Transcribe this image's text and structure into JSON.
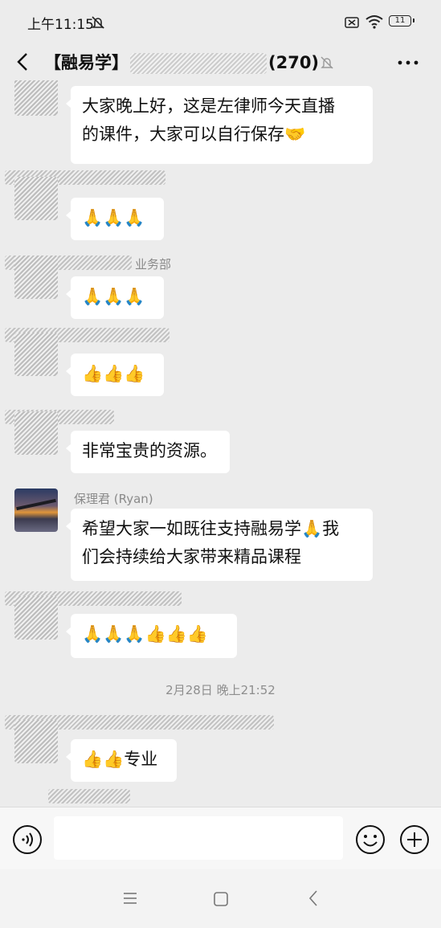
{
  "status_bar": {
    "time": "上午11:15",
    "battery": "11"
  },
  "header": {
    "title_prefix": "【融易学】",
    "title_suffix": "(270)"
  },
  "messages": [
    {
      "sender_visible": "",
      "text": "大家晚上好，这是左律师今天直播",
      "text2": "的课件，大家可以自行保存🤝"
    },
    {
      "sender_visible": "",
      "text": "🙏🙏🙏"
    },
    {
      "sender_visible": "业务部",
      "text": "🙏🙏🙏"
    },
    {
      "sender_visible": "",
      "text": "👍👍👍"
    },
    {
      "sender_visible": "",
      "text": "非常宝贵的资源。"
    },
    {
      "sender_visible": "保理君 (Ryan)",
      "text": "希望大家一如既往支持融易学🙏我",
      "text2": "们会持续给大家带来精品课程"
    },
    {
      "sender_visible": "",
      "text": "🙏🙏🙏👍👍👍"
    },
    {
      "sender_visible": "",
      "text": "👍👍专业"
    }
  ],
  "time_divider": "2月28日 晚上21:52",
  "input": {
    "placeholder": ""
  },
  "icons": [
    "mute-icon",
    "sim-icon",
    "wifi-icon",
    "back-icon",
    "more-icon",
    "voice-icon",
    "emoji-icon",
    "plus-icon",
    "menu-key-icon",
    "home-key-icon",
    "back-key-icon"
  ]
}
